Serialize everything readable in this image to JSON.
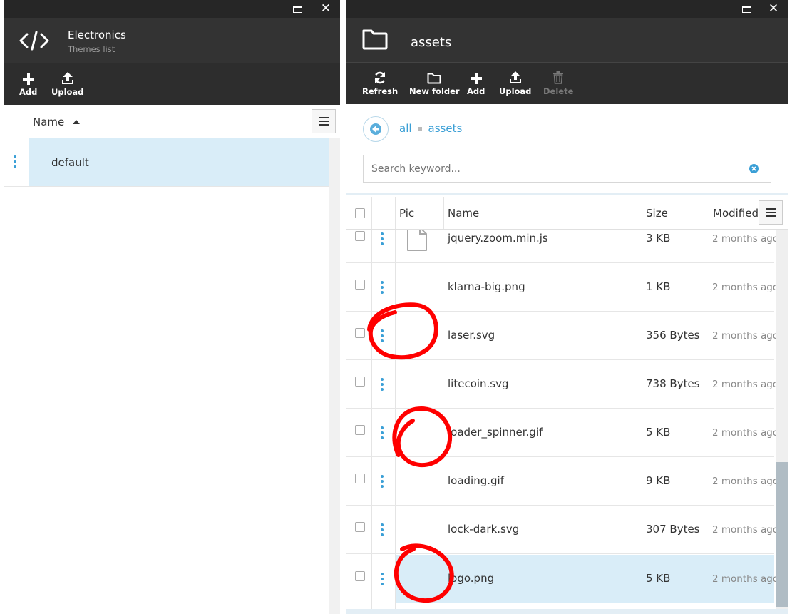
{
  "left_panel": {
    "app_title": "Electronics",
    "app_subtitle": "Themes list",
    "toolbar": {
      "add": "Add",
      "upload": "Upload"
    },
    "grid": {
      "column_name": "Name",
      "rows": [
        {
          "name": "default"
        }
      ]
    }
  },
  "right_panel": {
    "folder_title": "assets",
    "toolbar": {
      "refresh": "Refresh",
      "new_folder": "New folder",
      "add": "Add",
      "upload": "Upload",
      "delete": "Delete"
    },
    "breadcrumb": {
      "root": "all",
      "current": "assets"
    },
    "search": {
      "placeholder": "Search keyword..."
    },
    "columns": {
      "pic": "Pic",
      "name": "Name",
      "size": "Size",
      "modified": "Modified"
    },
    "rows": [
      {
        "name": "jquery.zoom.min.js",
        "size": "3 KB",
        "modified": "2 months ago",
        "icon": "file-icon"
      },
      {
        "name": "klarna-big.png",
        "size": "1 KB",
        "modified": "2 months ago"
      },
      {
        "name": "laser.svg",
        "size": "356 Bytes",
        "modified": "2 months ago"
      },
      {
        "name": "litecoin.svg",
        "size": "738 Bytes",
        "modified": "2 months ago"
      },
      {
        "name": "loader_spinner.gif",
        "size": "5 KB",
        "modified": "2 months ago"
      },
      {
        "name": "loading.gif",
        "size": "9 KB",
        "modified": "2 months ago"
      },
      {
        "name": "lock-dark.svg",
        "size": "307 Bytes",
        "modified": "2 months ago"
      },
      {
        "name": "logo.png",
        "size": "5 KB",
        "modified": "2 months ago",
        "selected": true
      }
    ]
  },
  "colors": {
    "accent": "#3a9fd6",
    "selected_row": "#d9edf8",
    "dark_header": "#333333",
    "annotation": "#ff0000"
  }
}
